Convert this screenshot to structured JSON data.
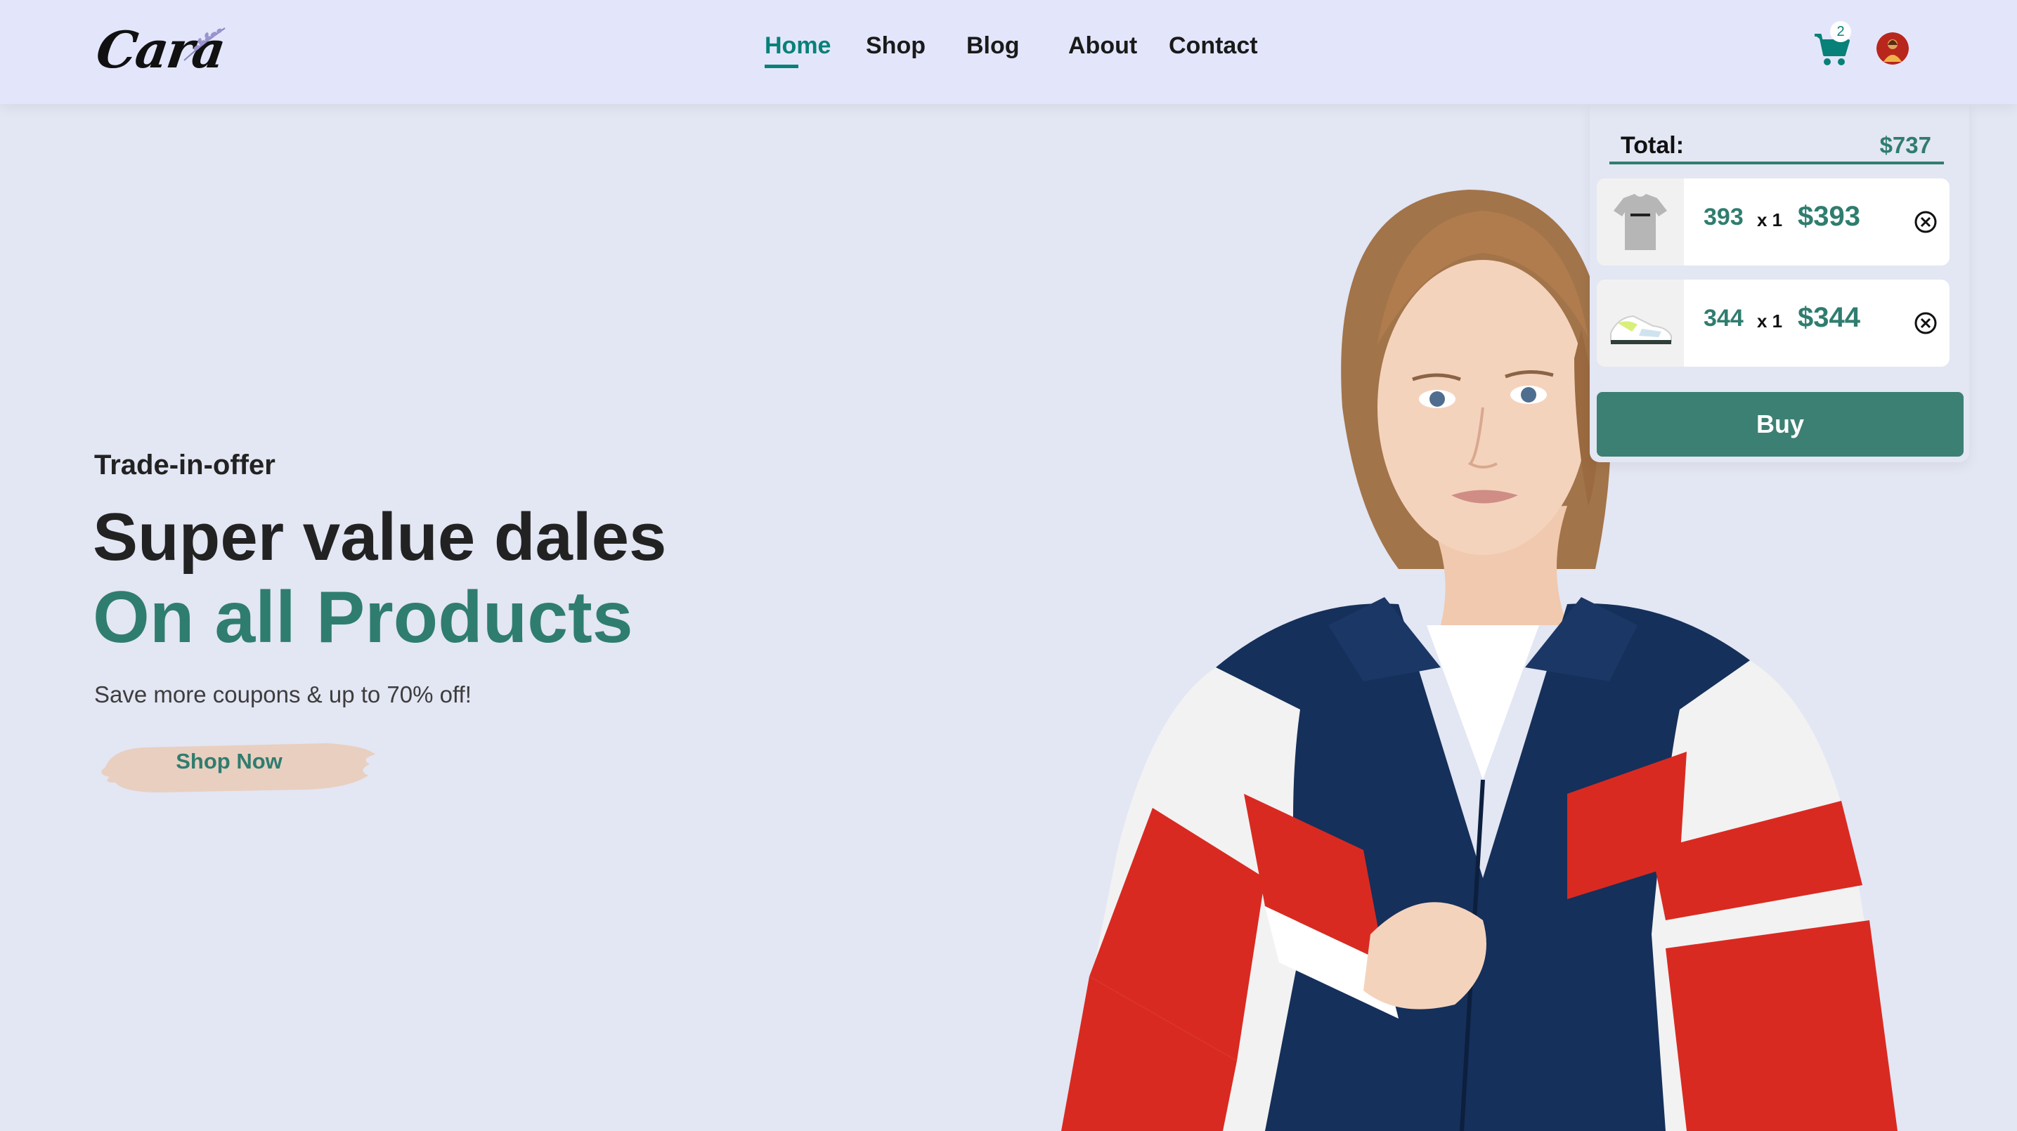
{
  "brand": {
    "logo_text": "Cara"
  },
  "nav": {
    "items": [
      {
        "label": "Home",
        "active": true
      },
      {
        "label": "Shop",
        "active": false
      },
      {
        "label": "Blog",
        "active": false
      },
      {
        "label": "About",
        "active": false
      },
      {
        "label": "Contact",
        "active": false
      }
    ]
  },
  "cart": {
    "count": "2",
    "icon": "cart-icon",
    "total_label": "Total:",
    "total_value": "$737",
    "items": [
      {
        "name": "393",
        "qty": "x 1",
        "price": "$393",
        "thumb": "tshirt-thumbnail"
      },
      {
        "name": "344",
        "qty": "x 1",
        "price": "$344",
        "thumb": "sneaker-thumbnail"
      }
    ],
    "buy_label": "Buy"
  },
  "hero": {
    "kicker": "Trade-in-offer",
    "title": "Super value dales",
    "subtitle": "On all Products",
    "description": "Save more coupons & up to 70% off!",
    "cta_label": "Shop Now"
  },
  "colors": {
    "accent": "#088178",
    "teal_text": "#2f7d6f",
    "buy_button": "#3c8073",
    "background": "#e3e6f3",
    "header": "#e3e6fb",
    "brush": "#e9cfc0"
  }
}
